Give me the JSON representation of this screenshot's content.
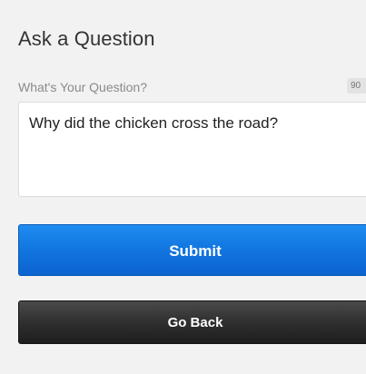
{
  "form": {
    "title": "Ask a Question",
    "question_label": "What's Your Question?",
    "char_counter": "90",
    "question_value": "Why did the chicken cross the road?"
  },
  "actions": {
    "submit_label": "Submit",
    "back_label": "Go Back"
  },
  "colors": {
    "background": "#f2f2f2",
    "submit_button": "#1275e0",
    "back_button": "#2f2f2f"
  }
}
